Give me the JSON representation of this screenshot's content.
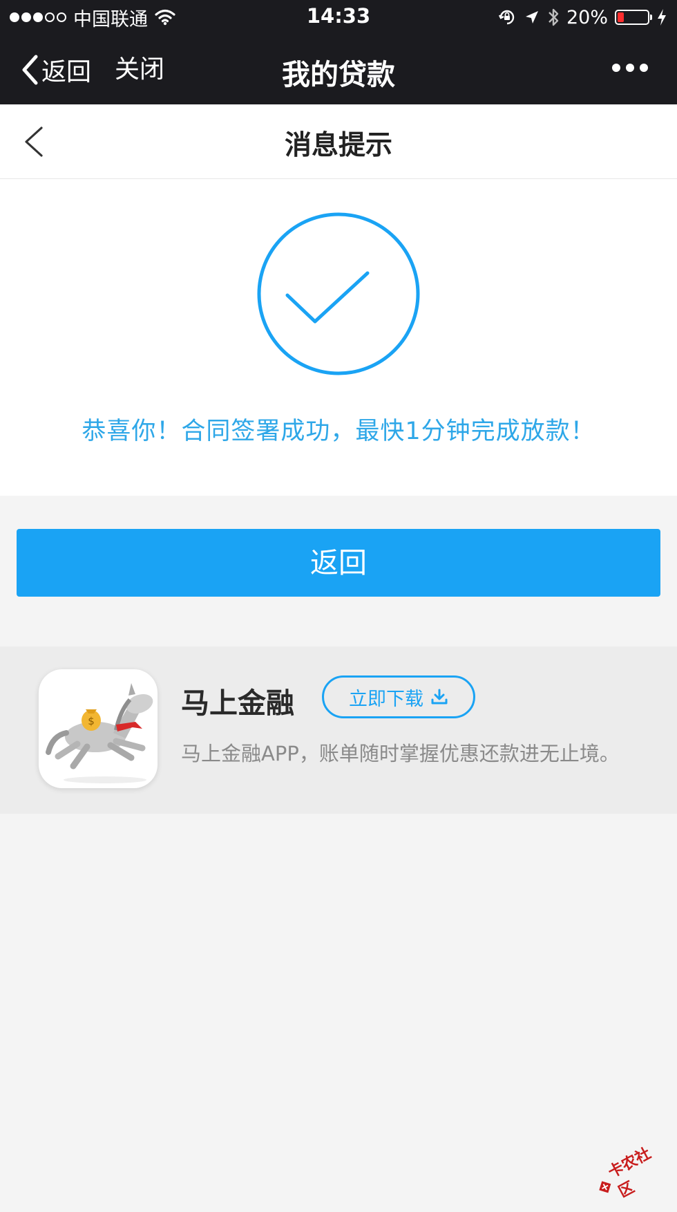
{
  "status_bar": {
    "carrier": "中国联通",
    "time": "14:33",
    "battery": "20%",
    "battery_level": 0.2
  },
  "wechat_nav": {
    "back_label": "返回",
    "close_label": "关闭",
    "title": "我的贷款"
  },
  "page_header": {
    "title": "消息提示"
  },
  "success": {
    "message": "恭喜你！合同签署成功，最快1分钟完成放款！"
  },
  "return_button": {
    "label": "返回"
  },
  "app_promo": {
    "name": "马上金融",
    "download_label": "立即下载",
    "description": "马上金融APP，账单随时掌握优惠还款进无止境。"
  },
  "watermark": {
    "text": "卡农社区"
  },
  "colors": {
    "accent": "#1aa3f4",
    "success_text": "#2ea7e8",
    "nav_background": "#1b1b1f",
    "battery_low": "#ff2e2e"
  },
  "icons": {
    "back": "chevron-left-icon",
    "more": "more-dots-icon",
    "success": "check-circle-icon",
    "download": "download-icon",
    "app": "horse-app-icon"
  }
}
